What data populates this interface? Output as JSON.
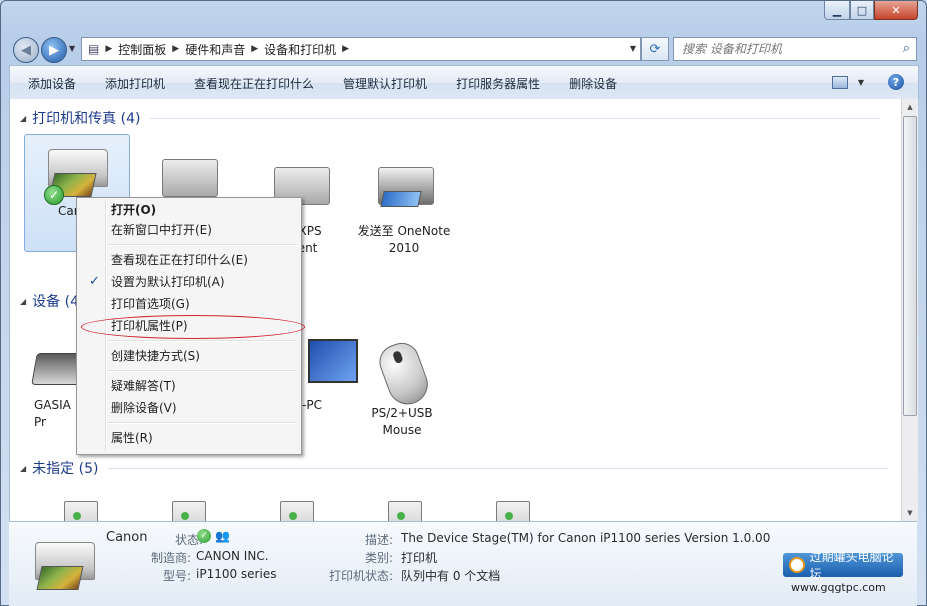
{
  "address": {
    "breadcrumbs": [
      "控制面板",
      "硬件和声音",
      "设备和打印机"
    ]
  },
  "search": {
    "placeholder": "搜索 设备和打印机"
  },
  "toolbar": {
    "items": [
      "添加设备",
      "添加打印机",
      "查看现在正在打印什么",
      "管理默认打印机",
      "打印服务器属性",
      "删除设备"
    ]
  },
  "groups": {
    "printers": "打印机和传真 (4)",
    "devices": "设备 (4",
    "unspecified": "未指定 (5)"
  },
  "printers": [
    {
      "name": "Can"
    },
    {
      "name": ""
    },
    {
      "name": "ft XPS\nment\ner"
    },
    {
      "name": "发送至 OneNote\n2010"
    }
  ],
  "devices": [
    {
      "name": "GASIA\nPr"
    },
    {
      "name": ""
    },
    {
      "name": "-PC"
    },
    {
      "name": "PS/2+USB\nMouse"
    }
  ],
  "context_menu": {
    "items": [
      "打开(O)",
      "在新窗口中打开(E)",
      "查看现在正在打印什么(E)",
      "设置为默认打印机(A)",
      "打印首选项(G)",
      "打印机属性(P)",
      "创建快捷方式(S)",
      "疑难解答(T)",
      "删除设备(V)",
      "属性(R)"
    ]
  },
  "details": {
    "name": "Canon",
    "status_label": "状态:",
    "maker_label": "制造商:",
    "maker": "CANON INC.",
    "model_label": "型号:",
    "model": "iP1100 series",
    "desc_label": "描述:",
    "desc": "The Device Stage(TM) for Canon iP1100 series Version 1.0.00",
    "category_label": "类别:",
    "category": "打印机",
    "printer_status_label": "打印机状态:",
    "printer_status": "队列中有 0 个文档"
  },
  "watermark": {
    "text": "过期罐头电脑论坛",
    "url": "www.gqgtpc.com"
  }
}
